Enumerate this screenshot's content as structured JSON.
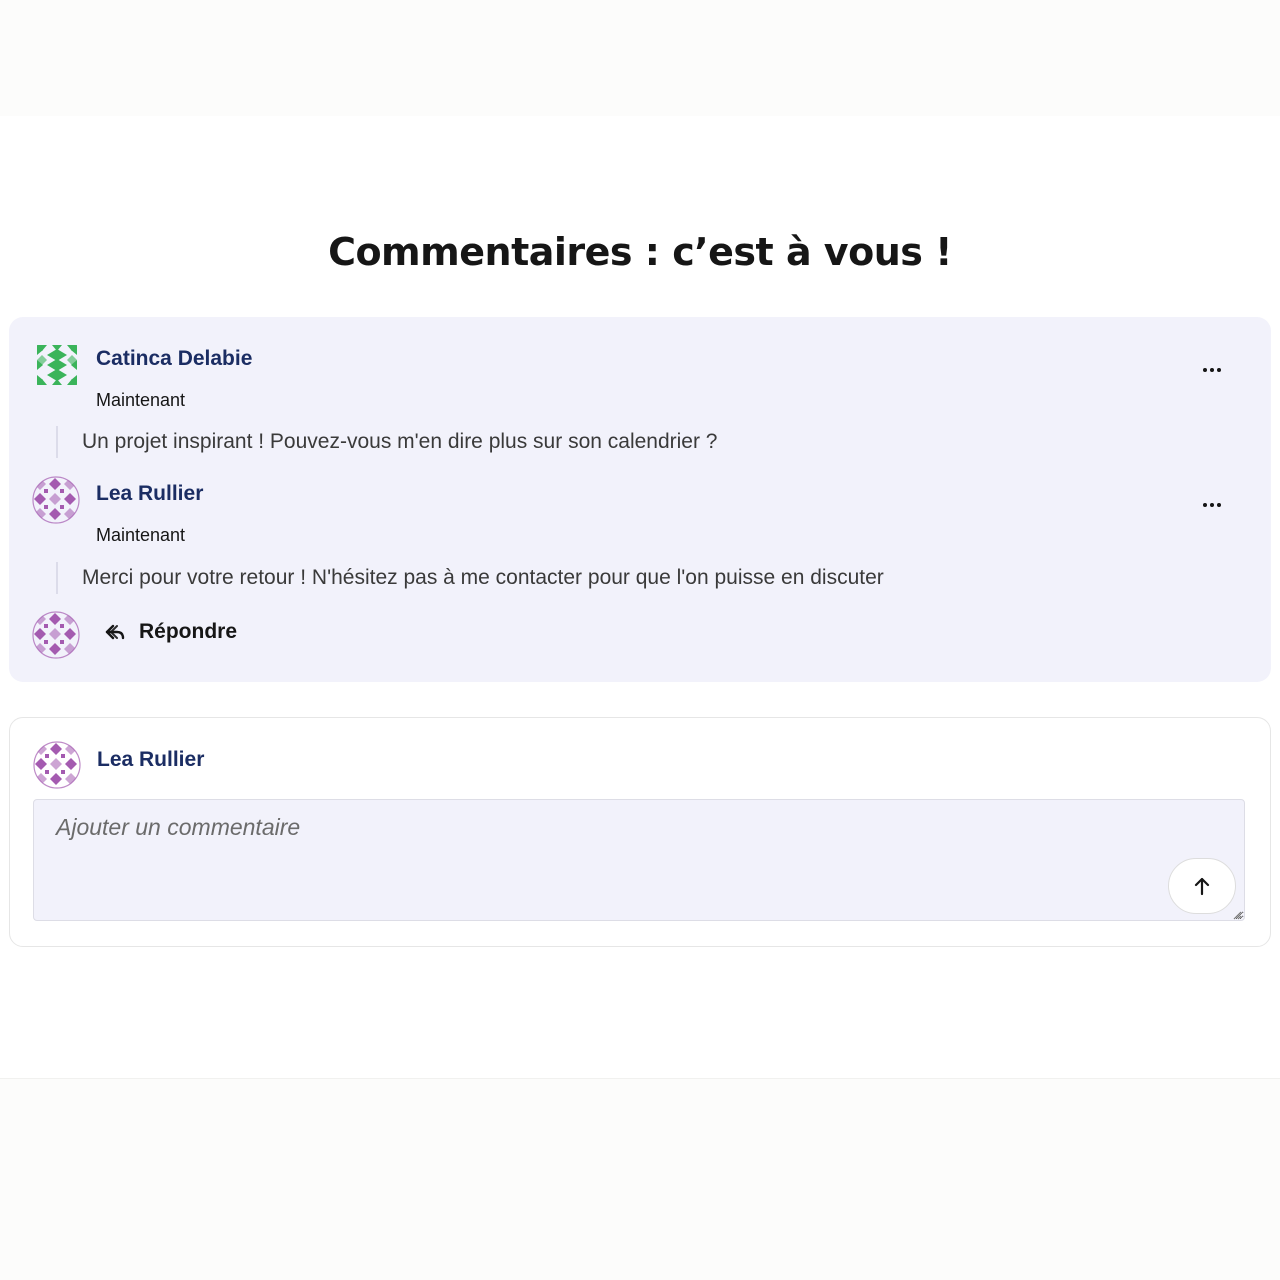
{
  "page": {
    "title": "Commentaires : c’est à vous !"
  },
  "thread": {
    "comments": [
      {
        "author": "Catinca Delabie",
        "timestamp": "Maintenant",
        "text": "Un projet inspirant ! Pouvez-vous m'en dire plus sur son calendrier ?",
        "avatar_icon": "green-pattern-avatar",
        "avatar_color": "#3bb45a",
        "menu_icon": "more-horizontal-icon"
      },
      {
        "author": "Lea Rullier",
        "timestamp": "Maintenant",
        "text": "Merci pour votre retour ! N'hésitez pas à me contacter pour que l'on puisse en discuter",
        "avatar_icon": "purple-pattern-avatar",
        "avatar_color": "#a45bb0",
        "menu_icon": "more-horizontal-icon"
      }
    ],
    "reply": {
      "label": "Répondre",
      "icon": "reply-arrow-icon"
    }
  },
  "composer": {
    "author": "Lea Rullier",
    "value": "",
    "placeholder": "Ajouter un commentaire",
    "send_icon": "arrow-up-icon"
  },
  "colors": {
    "thread_background": "#f2f2fb",
    "author_name": "#1b2d63",
    "text": "#3a3a3a"
  }
}
